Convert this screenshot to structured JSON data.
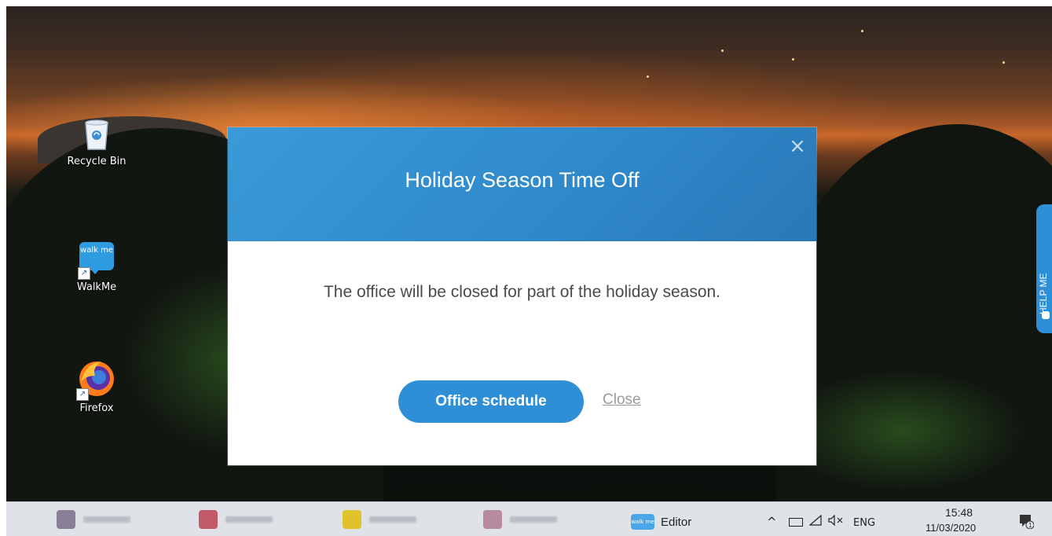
{
  "desktop": {
    "icons": [
      {
        "label": "Recycle Bin",
        "icon": "recycle-bin-icon"
      },
      {
        "label": "WalkMe",
        "icon": "walkme-icon",
        "art_text": "walk me"
      },
      {
        "label": "Firefox",
        "icon": "firefox-icon"
      }
    ]
  },
  "modal": {
    "title": "Holiday Season Time Off",
    "close_glyph": "×",
    "message": "The office will be closed for part of the holiday season.",
    "primary_button": "Office schedule",
    "secondary_link": "Close",
    "header_color": "#3a9ad8",
    "button_color": "#2f8fd6"
  },
  "help_tab": {
    "label": "HELP ME"
  },
  "taskbar": {
    "apps": [
      {
        "icon": "chrome-icon",
        "color": "#8a7f99"
      },
      {
        "icon": "chrome-icon",
        "color": "#c25a6a"
      },
      {
        "icon": "sticky-notes-icon",
        "color": "#e0c32a"
      },
      {
        "icon": "chrome-icon",
        "color": "#b88aa0"
      }
    ],
    "editor_icon_text": "walk me",
    "editor_label": "Editor",
    "tray": {
      "chevron": "^",
      "language": "ENG",
      "time": "15:48",
      "date": "11/03/2020"
    }
  }
}
